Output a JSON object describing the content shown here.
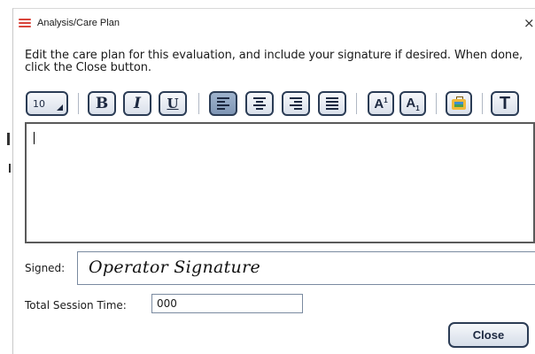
{
  "window": {
    "title": "Analysis/Care Plan",
    "close_glyph": "×"
  },
  "instructions": "Edit the care plan for this evaluation, and include your signature if desired. When done, click the Close button.",
  "toolbar": {
    "font_size": "10",
    "bold": "B",
    "italic": "I",
    "underline": "U",
    "superscript": "A",
    "superscript_mark": "1",
    "subscript": "A",
    "subscript_mark": "1",
    "text_style": "T",
    "icons": [
      "font-size-dropdown",
      "bold-icon",
      "italic-icon",
      "underline-icon",
      "align-left-icon",
      "align-center-icon",
      "align-right-icon",
      "align-justify-icon",
      "superscript-icon",
      "subscript-icon",
      "insert-image-icon",
      "text-format-icon"
    ],
    "active_alignment": "left"
  },
  "editor": {
    "content": ""
  },
  "signature": {
    "label": "Signed:",
    "value": "Operator Signature"
  },
  "session": {
    "label": "Total Session Time:",
    "value": "000"
  },
  "buttons": {
    "close": "Close"
  },
  "colors": {
    "accent_border": "#2b3c55",
    "active_button": "#8fa5c2",
    "app_icon": "#d9443a"
  }
}
